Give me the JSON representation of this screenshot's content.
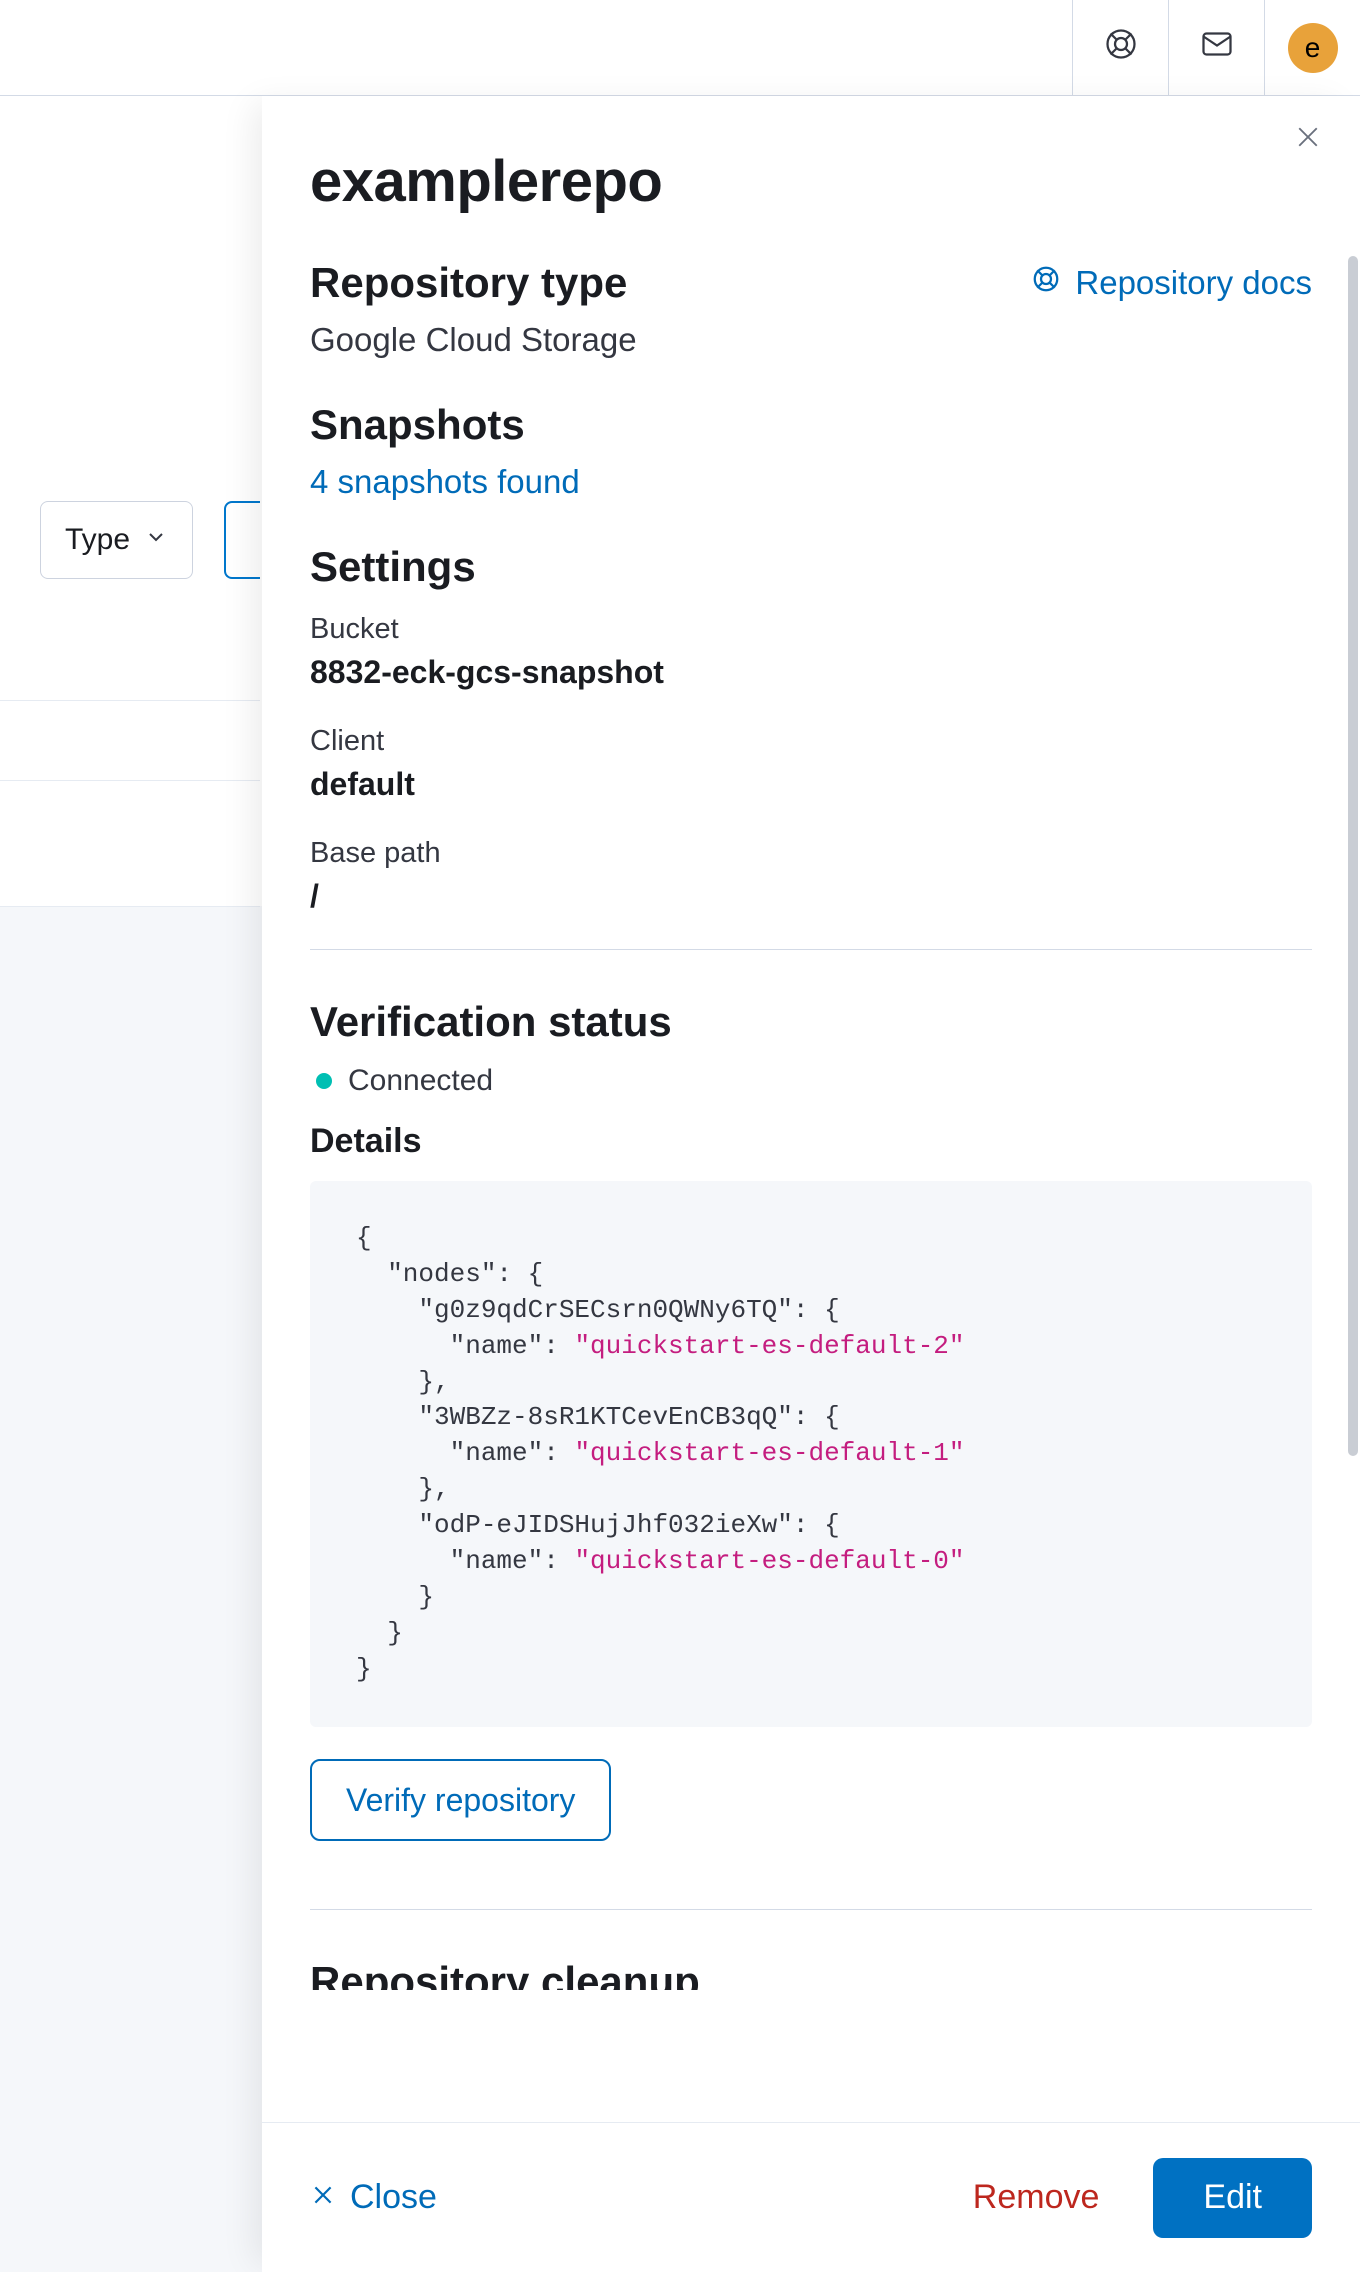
{
  "topbar": {
    "avatar_letter": "e"
  },
  "bg": {
    "type_filter_label": "Type"
  },
  "flyout": {
    "title": "examplerepo",
    "docs_link": "Repository docs",
    "sections": {
      "repository_type": {
        "heading": "Repository type",
        "value": "Google Cloud Storage"
      },
      "snapshots": {
        "heading": "Snapshots",
        "link": "4 snapshots found"
      },
      "settings": {
        "heading": "Settings",
        "bucket_label": "Bucket",
        "bucket_value": "8832-eck-gcs-snapshot",
        "client_label": "Client",
        "client_value": "default",
        "basepath_label": "Base path",
        "basepath_value": "/"
      },
      "verification": {
        "heading": "Verification status",
        "status": "Connected",
        "status_color": "#00bfb3",
        "details_heading": "Details",
        "details_json": {
          "nodes": {
            "g0z9qdCrSECsrn0QWNy6TQ": {
              "name": "quickstart-es-default-2"
            },
            "3WBZz-8sR1KTCevEnCB3qQ": {
              "name": "quickstart-es-default-1"
            },
            "odP-eJIDSHujJhf032ieXw": {
              "name": "quickstart-es-default-0"
            }
          }
        },
        "verify_button": "Verify repository"
      },
      "cleanup": {
        "heading": "Repository cleanup"
      }
    },
    "footer": {
      "close": "Close",
      "remove": "Remove",
      "edit": "Edit"
    }
  }
}
